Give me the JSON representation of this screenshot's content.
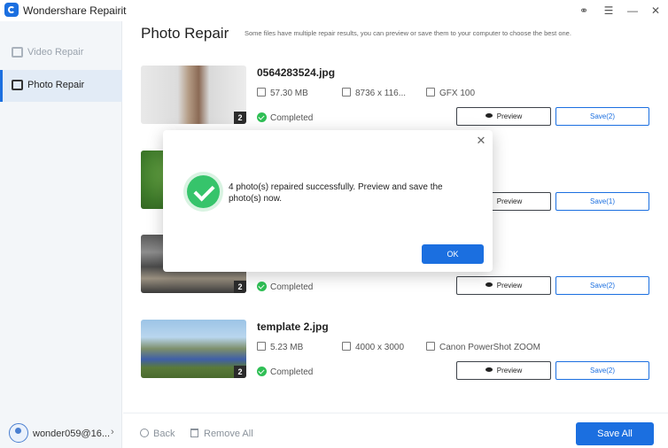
{
  "app": {
    "title": "Wondershare Repairit"
  },
  "sidebar": {
    "items": [
      {
        "label": "Video Repair"
      },
      {
        "label": "Photo Repair"
      }
    ],
    "user": {
      "name": "wonder059@16..."
    }
  },
  "header": {
    "title": "Photo Repair",
    "subtitle": "Some files have multiple repair results, you can preview or save them to your computer to choose the best one."
  },
  "files": [
    {
      "name": "0564283524.jpg",
      "size": "57.30 MB",
      "resolution": "8736 x 116...",
      "camera": "GFX 100",
      "status": "Completed",
      "count": "2",
      "preview_label": "Preview",
      "save_label": "Save(2)"
    },
    {
      "name": "",
      "size": "",
      "resolution": "",
      "camera": "",
      "status": "",
      "count": "",
      "preview_label": "Preview",
      "save_label": "Save(1)"
    },
    {
      "name": "",
      "size": "",
      "resolution": "",
      "camera": "",
      "status": "Completed",
      "count": "2",
      "preview_label": "Preview",
      "save_label": "Save(2)"
    },
    {
      "name": "template 2.jpg",
      "size": "5.23 MB",
      "resolution": "4000 x 3000",
      "camera": "Canon PowerShot ZOOM",
      "status": "Completed",
      "count": "2",
      "preview_label": "Preview",
      "save_label": "Save(2)"
    }
  ],
  "footer": {
    "back_label": "Back",
    "remove_label": "Remove All",
    "save_all_label": "Save All"
  },
  "modal": {
    "message": "4 photo(s) repaired successfully. Preview and save the photo(s) now.",
    "ok_label": "OK"
  },
  "colors": {
    "accent": "#1b6fe0",
    "success": "#36c46b"
  }
}
